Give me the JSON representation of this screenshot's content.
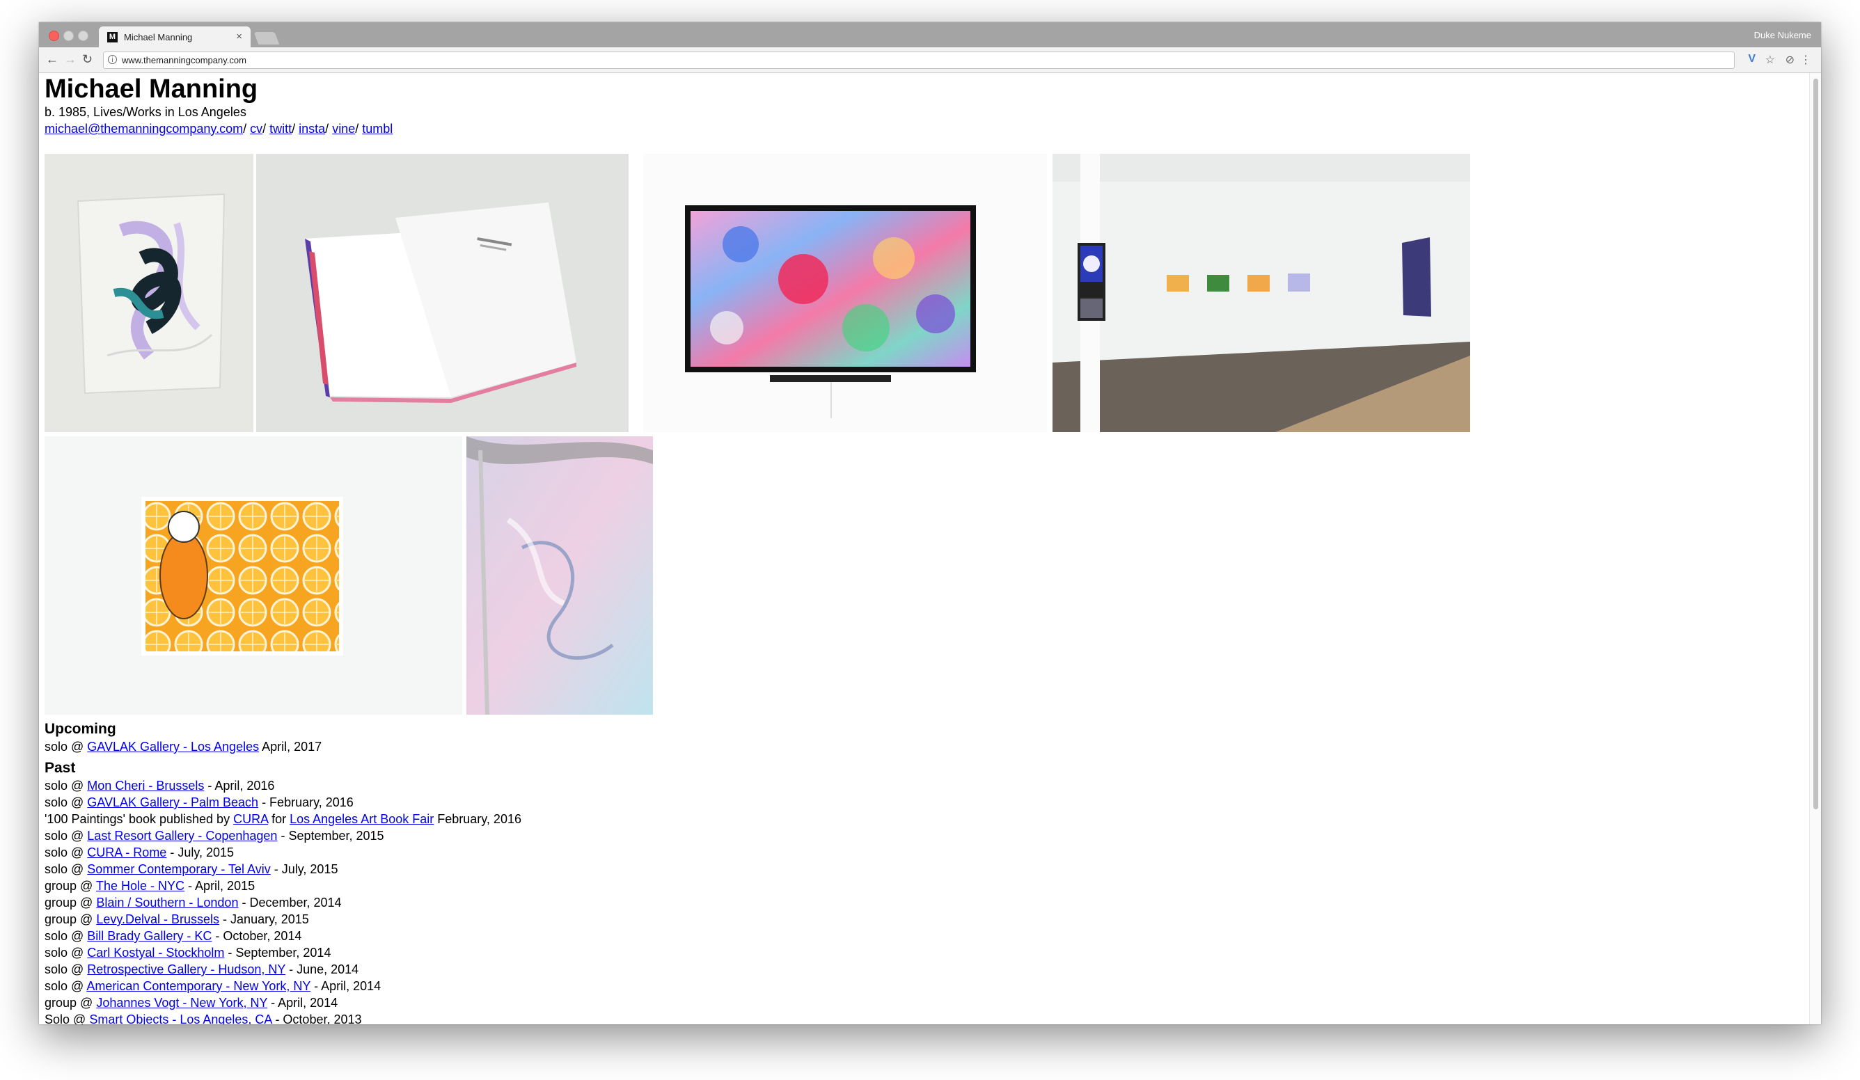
{
  "browser": {
    "tab_title": "Michael Manning",
    "tab_favicon": "M",
    "tab_close": "×",
    "profile_name": "Duke Nukeme",
    "url": "www.themanningcompany.com",
    "icons": [
      "back-arrow-icon",
      "forward-arrow-icon",
      "reload-icon",
      "info-icon",
      "vimeo-extension-icon",
      "star-icon",
      "extension-icon",
      "menu-icon"
    ]
  },
  "page": {
    "name": "Michael Manning",
    "bio": "b. 1985, Lives/Works in Los Angeles",
    "links": [
      {
        "label": "michael@themanningcompany.com",
        "sep": "/ "
      },
      {
        "label": "cv",
        "sep": "/ "
      },
      {
        "label": "twitt",
        "sep": "/ "
      },
      {
        "label": "insta",
        "sep": "/ "
      },
      {
        "label": "vine",
        "sep": "/ "
      },
      {
        "label": "tumbl",
        "sep": ""
      }
    ]
  },
  "gallery": {
    "images": [
      "abstract-painting-image",
      "open-book-image",
      "screen-artwork-image",
      "gallery-installation-image",
      "orange-painting-image",
      "pastel-detail-image"
    ]
  },
  "exhibitions": {
    "upcoming_heading": "Upcoming",
    "upcoming": [
      {
        "prefix": "solo @ ",
        "link": "GAVLAK Gallery - Los Angeles",
        "suffix": " April, 2017"
      }
    ],
    "past_heading": "Past",
    "past": [
      {
        "prefix": "solo @ ",
        "link": "Mon Cheri - Brussels",
        "suffix": " - April, 2016"
      },
      {
        "prefix": "solo @ ",
        "link": "GAVLAK Gallery - Palm Beach",
        "suffix": " - February, 2016"
      },
      {
        "prefix": "'100 Paintings' book published by ",
        "link": "CURA",
        "mid": " for ",
        "link2": "Los Angeles Art Book Fair",
        "suffix": " February, 2016"
      },
      {
        "prefix": "solo @ ",
        "link": "Last Resort Gallery - Copenhagen",
        "suffix": " - September, 2015"
      },
      {
        "prefix": "solo @ ",
        "link": "CURA - Rome",
        "suffix": " - July, 2015"
      },
      {
        "prefix": "solo @ ",
        "link": "Sommer Contemporary - Tel Aviv",
        "suffix": " - July, 2015"
      },
      {
        "prefix": "group @ ",
        "link": "The Hole - NYC",
        "suffix": " - April, 2015"
      },
      {
        "prefix": "group @ ",
        "link": "Blain / Southern - London",
        "suffix": " - December, 2014"
      },
      {
        "prefix": "group @ ",
        "link": "Levy.Delval - Brussels",
        "suffix": " - January, 2015"
      },
      {
        "prefix": "solo @ ",
        "link": "Bill Brady Gallery - KC",
        "suffix": " - October, 2014"
      },
      {
        "prefix": "solo @ ",
        "link": "Carl Kostyal - Stockholm",
        "suffix": " - September, 2014"
      },
      {
        "prefix": "solo @ ",
        "link": "Retrospective Gallery - Hudson, NY",
        "suffix": " - June, 2014"
      },
      {
        "prefix": "solo @ ",
        "link": "American Contemporary - New York, NY",
        "suffix": " - April, 2014"
      },
      {
        "prefix": "group @ ",
        "link": "Johannes Vogt - New York, NY",
        "suffix": " - April, 2014"
      },
      {
        "prefix": "Solo @ ",
        "link": "Smart Objects - Los Angeles, CA",
        "suffix": " - October, 2013"
      }
    ]
  },
  "colors": {
    "link": "#0000ee",
    "tab_bar": "#a4a4a4",
    "toolbar": "#f2f2f2",
    "close_red": "#fc605c"
  }
}
